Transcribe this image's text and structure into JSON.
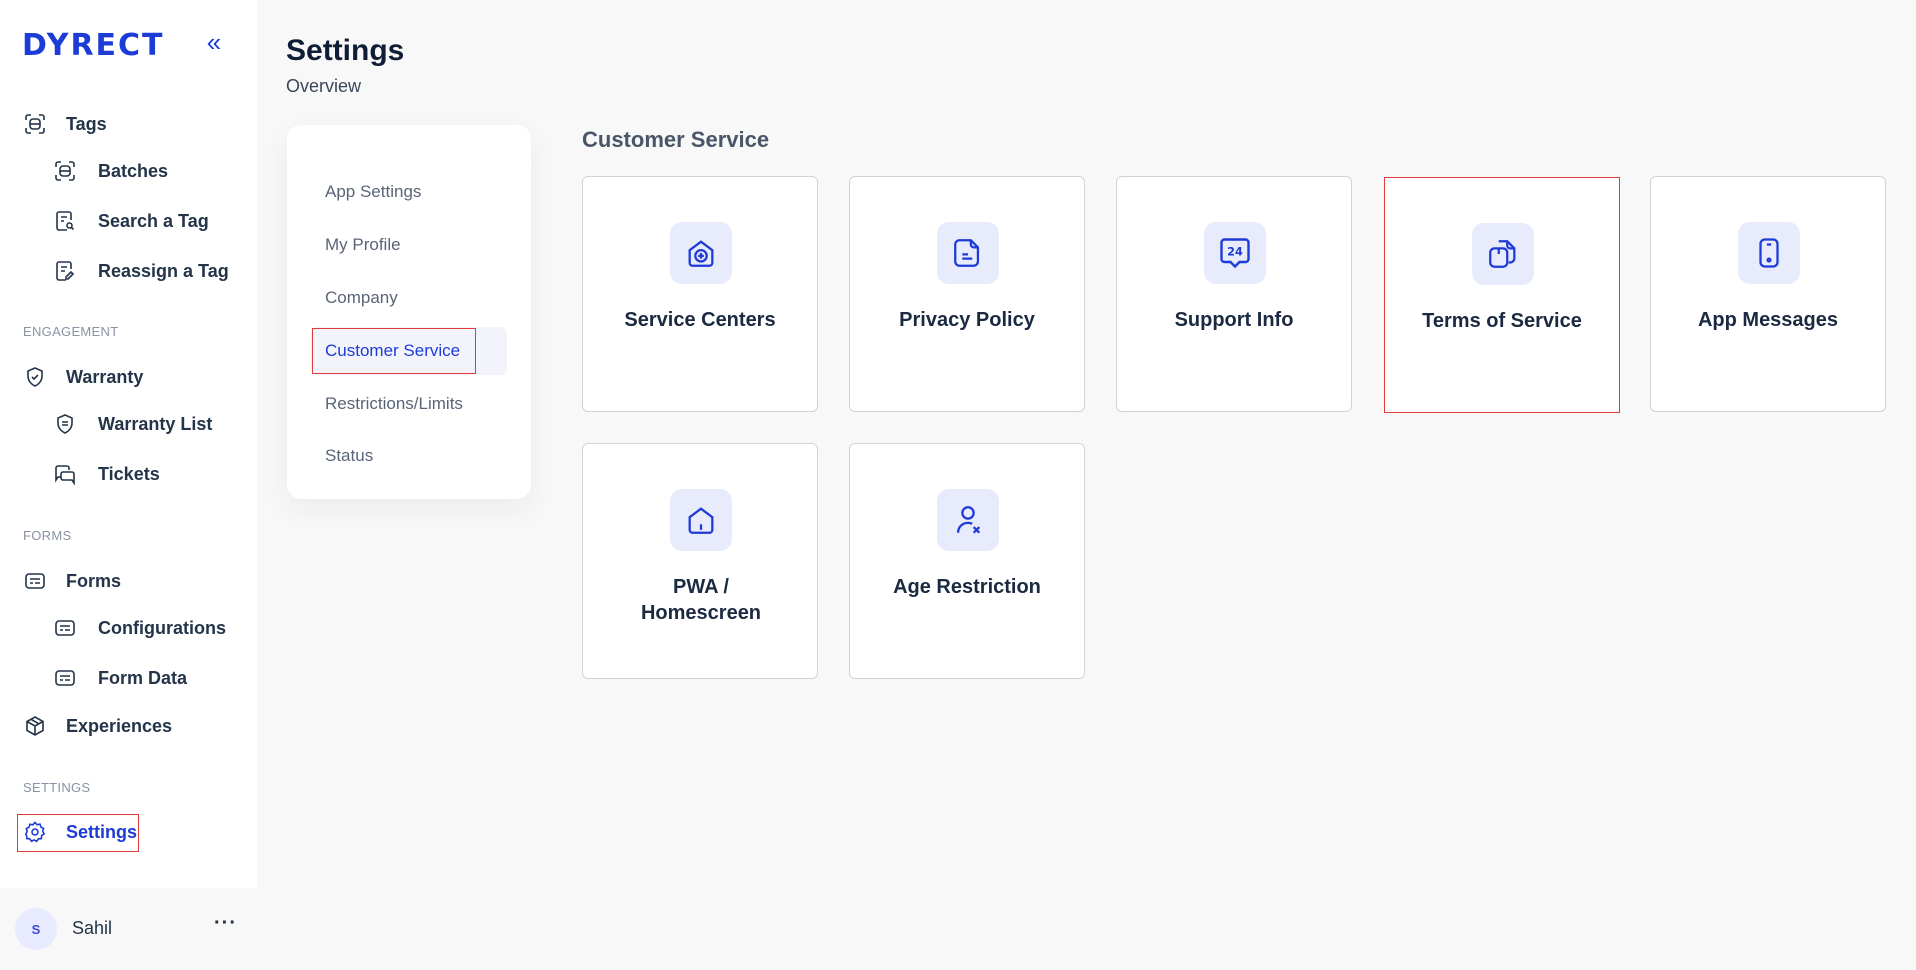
{
  "app": {
    "logo": "DYRECT",
    "collapse_glyph": "«"
  },
  "sidebar": {
    "top_items": [
      {
        "label": "Tags",
        "icon": "tag-scan-icon"
      },
      {
        "label": "Batches",
        "icon": "tag-scan-icon"
      },
      {
        "label": "Search a Tag",
        "icon": "search-doc-icon"
      },
      {
        "label": "Reassign a Tag",
        "icon": "edit-doc-icon"
      }
    ],
    "sections": {
      "engagement": "ENGAGEMENT",
      "forms": "FORMS",
      "settings": "SETTINGS"
    },
    "engagement_items": [
      {
        "label": "Warranty",
        "icon": "shield-check-icon"
      },
      {
        "label": "Warranty List",
        "icon": "shield-list-icon"
      },
      {
        "label": "Tickets",
        "icon": "chat-bubbles-icon"
      }
    ],
    "forms_items": [
      {
        "label": "Forms",
        "icon": "form-icon"
      },
      {
        "label": "Configurations",
        "icon": "form-icon"
      },
      {
        "label": "Form Data",
        "icon": "form-icon"
      },
      {
        "label": "Experiences",
        "icon": "cube-icon"
      }
    ],
    "settings_item": {
      "label": "Settings",
      "icon": "gear-icon"
    },
    "user": {
      "initial": "S",
      "name": "Sahil",
      "more": "···"
    }
  },
  "header": {
    "title": "Settings",
    "subtitle": "Overview"
  },
  "submenu": {
    "items": [
      "App Settings",
      "My Profile",
      "Company",
      "Customer Service",
      "Restrictions/Limits",
      "Status"
    ],
    "active": "Customer Service"
  },
  "content": {
    "section_title": "Customer Service",
    "cards": [
      {
        "label": "Service Centers",
        "icon": "home-plus-icon"
      },
      {
        "label": "Privacy Policy",
        "icon": "document-icon"
      },
      {
        "label": "Support Info",
        "icon": "support-24-icon",
        "icon_text": "24"
      },
      {
        "label": "Terms of Service",
        "icon": "copy-documents-icon"
      },
      {
        "label": "App Messages",
        "icon": "mobile-icon"
      },
      {
        "label": "PWA / Homescreen",
        "icon": "home-icon"
      },
      {
        "label": "Age Restriction",
        "icon": "user-remove-icon"
      }
    ]
  },
  "colors": {
    "accent": "#1d3bd6",
    "highlight_border": "#e03a3a",
    "icon_bg": "#e8ebfb"
  }
}
